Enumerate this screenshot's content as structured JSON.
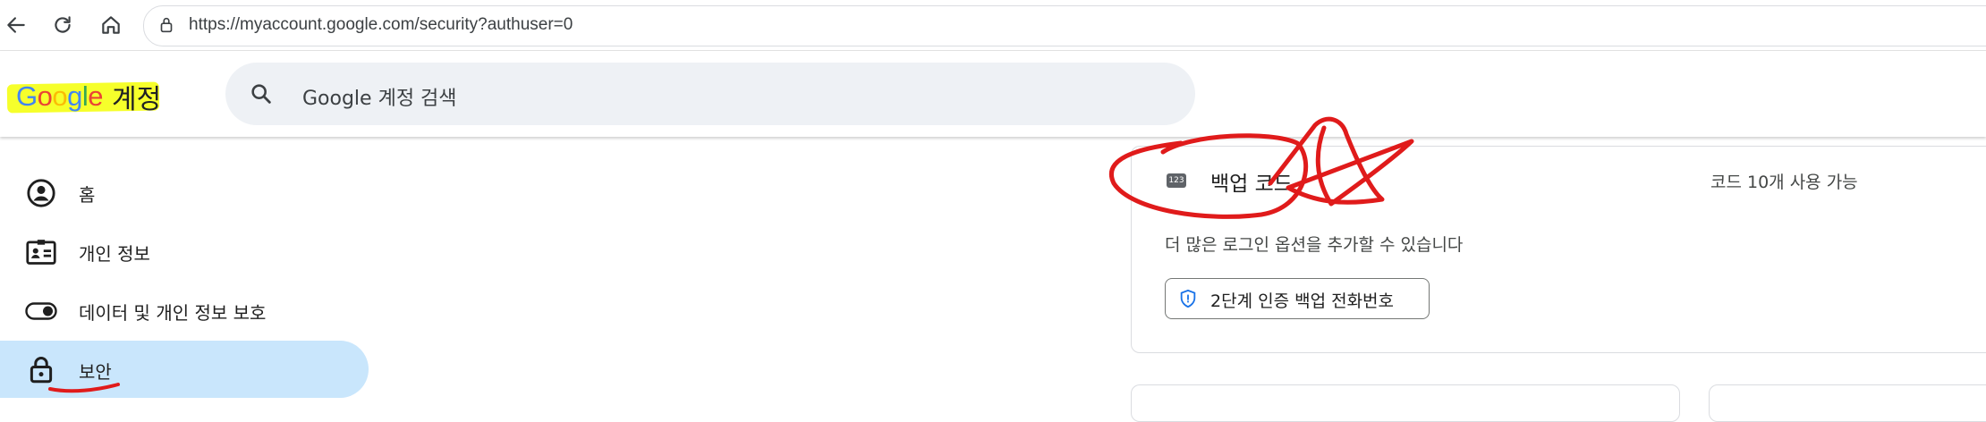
{
  "browser": {
    "url": "https://myaccount.google.com/security?authuser=0",
    "icons": [
      "back-arrow-icon",
      "reload-icon",
      "home-icon",
      "lock-icon"
    ]
  },
  "header": {
    "logo_word": "Google",
    "logo_letters": [
      {
        "ch": "G",
        "color": "#4285F4"
      },
      {
        "ch": "o",
        "color": "#EA4335"
      },
      {
        "ch": "o",
        "color": "#FBBC05"
      },
      {
        "ch": "g",
        "color": "#4285F4"
      },
      {
        "ch": "l",
        "color": "#34A853"
      },
      {
        "ch": "e",
        "color": "#EA4335"
      }
    ],
    "logo_suffix": "계정",
    "search_placeholder": "Google 계정 검색"
  },
  "sidebar": {
    "items": [
      {
        "label": "홈",
        "icon": "account-circle-icon",
        "active": false
      },
      {
        "label": "개인 정보",
        "icon": "id-card-icon",
        "active": false
      },
      {
        "label": "데이터 및 개인 정보 보호",
        "icon": "toggle-icon",
        "active": false
      },
      {
        "label": "보안",
        "icon": "lock-icon",
        "active": true
      }
    ]
  },
  "backup_card": {
    "title": "백업 코드",
    "icon": "123-code-icon",
    "icon_text": "123",
    "status": "코드 10개 사용 가능",
    "description": "더 많은 로그인 옵션을 추가할 수 있습니다",
    "chip_label": "2단계 인증 백업 전화번호",
    "chip_icon": "shield-icon"
  },
  "colors": {
    "active_bg": "#c9e6fc",
    "highlight": "#f6ff2b",
    "annotation_red": "#e01b1b",
    "chip_icon_blue": "#1a73e8"
  }
}
